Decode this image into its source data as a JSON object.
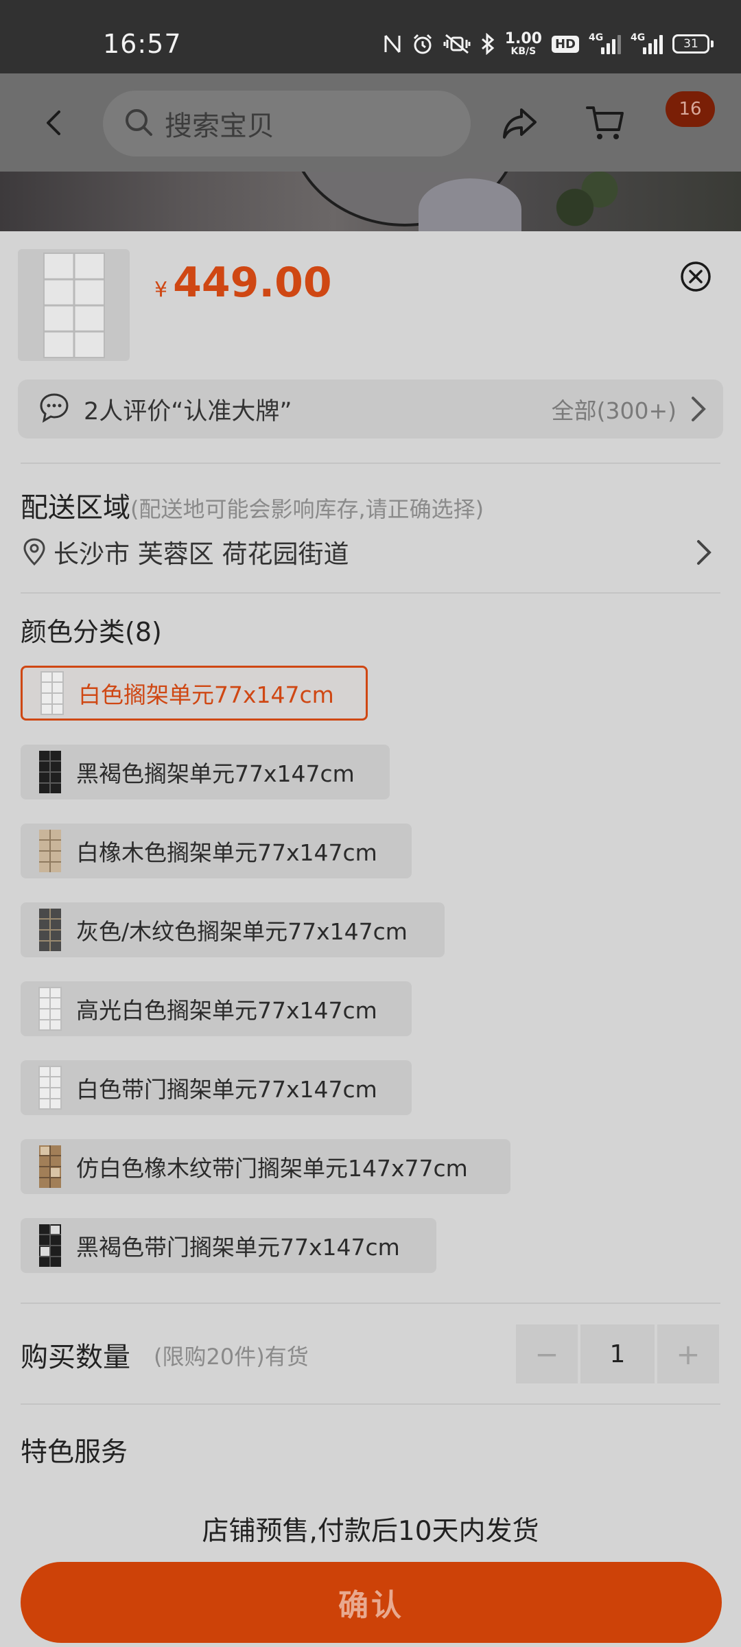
{
  "status_bar": {
    "time": "16:57",
    "net_speed_value": "1.00",
    "net_speed_unit": "KB/S",
    "hd_label": "HD",
    "signal1_label": "4G",
    "signal2_label": "4G",
    "battery": "31"
  },
  "nav": {
    "search_placeholder": "搜索宝贝",
    "cart_badge": "16"
  },
  "product": {
    "currency": "¥",
    "price": "449.00"
  },
  "reviews": {
    "summary": "2人评价“认准大牌”",
    "all_label": "全部(300+)"
  },
  "delivery": {
    "title": "配送区域",
    "note": "(配送地可能会影响库存,请正确选择)",
    "address": "长沙市 芙蓉区 荷花园街道"
  },
  "colors": {
    "title": "颜色分类(8)",
    "options": [
      {
        "label": "白色搁架单元77x147cm",
        "selected": true,
        "swatch": "white"
      },
      {
        "label": "黑褐色搁架单元77x147cm",
        "selected": false,
        "swatch": "black"
      },
      {
        "label": "白橡木色搁架单元77x147cm",
        "selected": false,
        "swatch": "oak"
      },
      {
        "label": "灰色/木纹色搁架单元77x147cm",
        "selected": false,
        "swatch": "gray"
      },
      {
        "label": "高光白色搁架单元77x147cm",
        "selected": false,
        "swatch": "white"
      },
      {
        "label": "白色带门搁架单元77x147cm",
        "selected": false,
        "swatch": "white"
      },
      {
        "label": "仿白色橡木纹带门搁架单元147x77cm",
        "selected": false,
        "swatch": "oak-door"
      },
      {
        "label": "黑褐色带门搁架单元77x147cm",
        "selected": false,
        "swatch": "black-door"
      }
    ]
  },
  "quantity": {
    "label": "购买数量",
    "note": "(限购20件)有货",
    "value": "1",
    "minus": "−",
    "plus": "+"
  },
  "service": {
    "title": "特色服务",
    "presale": "店铺预售,付款后10天内发货"
  },
  "confirm_label": "确认",
  "colors_theme": {
    "accent": "#cf4713",
    "button": "#cd4208"
  }
}
